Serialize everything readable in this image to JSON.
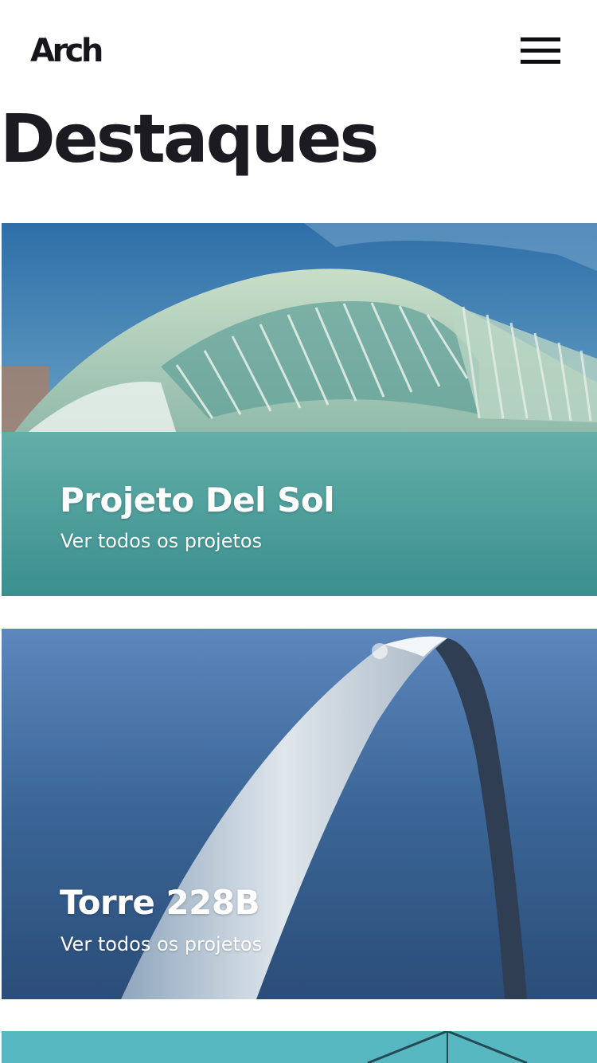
{
  "header": {
    "logo_text": "Arch",
    "menu_icon": "hamburger-menu-icon"
  },
  "page": {
    "title": "Destaques"
  },
  "projects": [
    {
      "title": "Projeto Del Sol",
      "link_label": "Ver todos os projetos",
      "image": "futuristic-dome-building-over-water"
    },
    {
      "title": "Torre 228B",
      "link_label": "Ver todos os projetos",
      "image": "steel-arch-against-blue-sky"
    },
    {
      "title": "",
      "link_label": "",
      "image": "turquoise-structure-partial"
    }
  ],
  "colors": {
    "text_dark": "#1b1b21",
    "card_text": "#ffffff",
    "water_teal": "#5fb3b0",
    "sky_blue": "#3f6a9e"
  }
}
